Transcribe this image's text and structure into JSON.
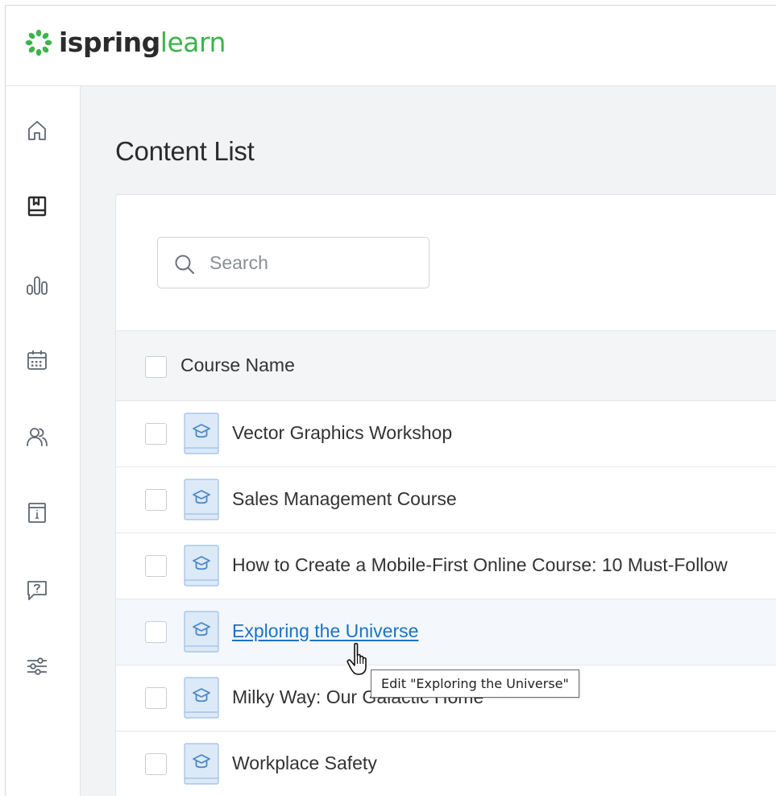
{
  "brand": {
    "name_part1": "ispring",
    "name_part2": "learn",
    "accent_color": "#3bb54a"
  },
  "sidebar": {
    "items": [
      {
        "icon": "home-icon"
      },
      {
        "icon": "content-book-icon"
      },
      {
        "icon": "reports-bar-chart-icon"
      },
      {
        "icon": "calendar-icon"
      },
      {
        "icon": "users-icon"
      },
      {
        "icon": "info-board-icon"
      },
      {
        "icon": "help-question-icon"
      },
      {
        "icon": "settings-sliders-icon"
      }
    ]
  },
  "page": {
    "title": "Content List"
  },
  "search": {
    "placeholder": "Search",
    "value": ""
  },
  "table": {
    "column_header": "Course Name",
    "rows": [
      {
        "title": "Vector Graphics Workshop",
        "hovered": false
      },
      {
        "title": "Sales Management Course",
        "hovered": false
      },
      {
        "title": "How to Create a Mobile-First Online Course: 10 Must-Follow",
        "hovered": false
      },
      {
        "title": "Exploring the Universe",
        "hovered": true
      },
      {
        "title": "Milky Way: Our Galactic Home",
        "hovered": false
      },
      {
        "title": "Workplace Safety",
        "hovered": false
      }
    ]
  },
  "tooltip": {
    "text": "Edit \"Exploring the Universe\""
  },
  "colors": {
    "link": "#1a73c7",
    "course_icon_bg": "#dce9f7",
    "course_icon_stroke": "#4a89c8"
  }
}
